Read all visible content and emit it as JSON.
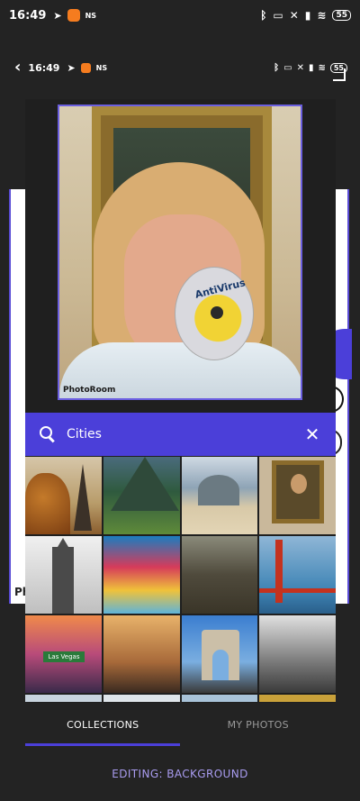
{
  "status_bar": {
    "time": "16:49",
    "notif_ns": "NS",
    "battery": "55"
  },
  "inner_status_bar": {
    "time": "16:49",
    "notif_ns": "NS",
    "battery": "55"
  },
  "background_frame": {
    "partial_label": "Ph"
  },
  "preview": {
    "watermark": "PhotoRoom",
    "cd_label": "AntiVirus"
  },
  "search": {
    "value": "Cities"
  },
  "grid": {
    "tiles": [
      {
        "name": "eiffel-tower"
      },
      {
        "name": "mountain-terraces"
      },
      {
        "name": "beach-city"
      },
      {
        "name": "mona-lisa-museum"
      },
      {
        "name": "skyscraper"
      },
      {
        "name": "neon-street"
      },
      {
        "name": "great-wall"
      },
      {
        "name": "golden-gate-bridge"
      },
      {
        "name": "las-vegas-sign",
        "sign_text": "Las Vegas"
      },
      {
        "name": "san-francisco-street"
      },
      {
        "name": "arc-de-triomphe"
      },
      {
        "name": "bw-bridge-street"
      },
      {
        "name": "city-tile-13"
      },
      {
        "name": "city-tile-14"
      },
      {
        "name": "city-tile-15"
      },
      {
        "name": "city-tile-16"
      }
    ]
  },
  "tabs": {
    "collections": "COLLECTIONS",
    "my_photos": "MY PHOTOS",
    "active": "collections"
  },
  "footer": {
    "editing_label": "EDITING: BACKGROUND"
  },
  "colors": {
    "accent": "#4b3fd9",
    "background": "#232323",
    "footer_text": "#a99cf0"
  },
  "icons": [
    "back-arrow-icon",
    "search-icon",
    "close-icon",
    "expand-icon",
    "wifi-icon",
    "bluetooth-icon",
    "signal-icon",
    "battery-icon"
  ]
}
